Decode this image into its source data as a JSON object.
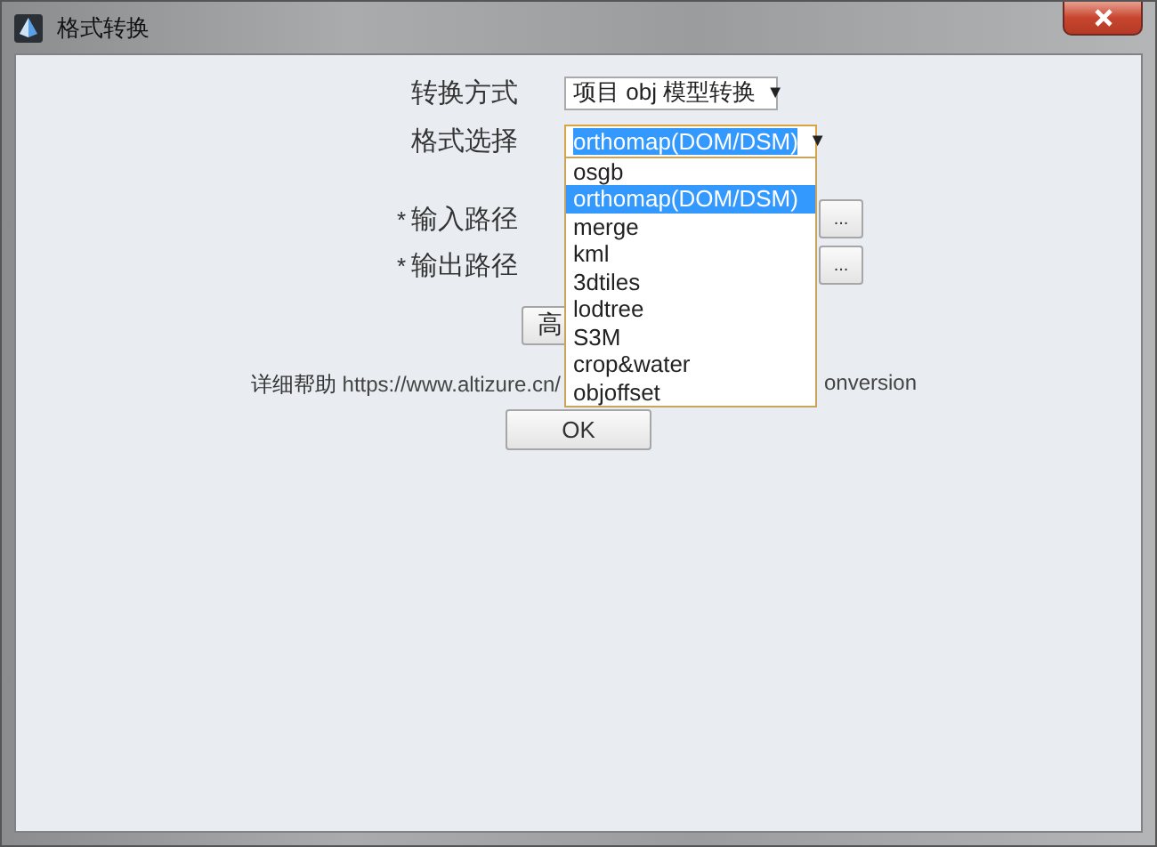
{
  "window": {
    "title": "格式转换"
  },
  "form": {
    "conversion_mode": {
      "label": "转换方式",
      "value": "项目 obj 模型转换",
      "arrow": "▼"
    },
    "format": {
      "label": "格式选择",
      "value": "orthomap(DOM/DSM)",
      "arrow": "▼",
      "expanded": true,
      "options": [
        {
          "label": "osgb",
          "selected": false
        },
        {
          "label": "orthomap(DOM/DSM)",
          "selected": true
        },
        {
          "label": "merge",
          "selected": false
        },
        {
          "label": "kml",
          "selected": false
        },
        {
          "label": "3dtiles",
          "selected": false
        },
        {
          "label": "lodtree",
          "selected": false
        },
        {
          "label": "S3M",
          "selected": false
        },
        {
          "label": "crop&water",
          "selected": false
        },
        {
          "label": "objoffset",
          "selected": false
        }
      ]
    },
    "paths": [
      {
        "required_mark": "*",
        "label": "输入路径",
        "browse": "..."
      },
      {
        "required_mark": "*",
        "label": "输出路径",
        "browse": "..."
      }
    ],
    "advanced_button": "高",
    "help": {
      "label": "详细帮助",
      "url_start": "https://www.altizure.cn/",
      "url_end": "onversion"
    },
    "ok_button": "OK"
  }
}
